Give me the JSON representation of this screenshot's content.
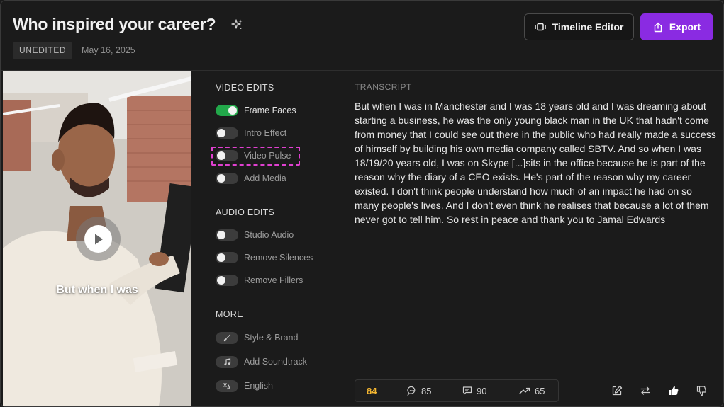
{
  "header": {
    "title": "Who inspired your career?",
    "status_badge": "UNEDITED",
    "date": "May 16, 2025",
    "timeline_label": "Timeline Editor",
    "export_label": "Export"
  },
  "video": {
    "caption": "But when I was"
  },
  "edits": {
    "video_heading": "VIDEO EDITS",
    "video_items": [
      {
        "label": "Frame Faces",
        "enabled": true
      },
      {
        "label": "Intro Effect",
        "enabled": false
      },
      {
        "label": "Video Pulse",
        "enabled": false
      },
      {
        "label": "Add Media",
        "enabled": false
      }
    ],
    "audio_heading": "AUDIO EDITS",
    "audio_items": [
      {
        "label": "Studio Audio",
        "enabled": false
      },
      {
        "label": "Remove Silences",
        "enabled": false
      },
      {
        "label": "Remove Fillers",
        "enabled": false
      }
    ],
    "more_heading": "MORE",
    "more_items": [
      {
        "label": "Style & Brand",
        "icon": "brush-icon"
      },
      {
        "label": "Add Soundtrack",
        "icon": "music-note-icon"
      },
      {
        "label": "English",
        "icon": "translate-icon"
      }
    ]
  },
  "transcript": {
    "heading": "TRANSCRIPT",
    "text": "But when I was in Manchester and I was 18 years old and I was dreaming about starting a business, he was the only young black man in the UK that hadn't come from money that I could see out there in the public who had really made a success of himself by building his own media company called SBTV. And so when I was 18/19/20 years old, I was on Skype [...]sits in the office because he is part of the reason why the diary of a CEO exists. He's part of the reason why my career existed. I don't think people understand how much of an impact he had on so many people's lives. And I don't even think he realises that because a lot of them never got to tell him. So rest in peace and thank you to Jamal Edwards"
  },
  "stats": {
    "score": "84",
    "comments": "85",
    "chats": "90",
    "trend": "65"
  },
  "colors": {
    "accent": "#8a2be2",
    "toggle_on": "#22a84a",
    "score": "#f5b731",
    "highlight": "#e040d0"
  }
}
